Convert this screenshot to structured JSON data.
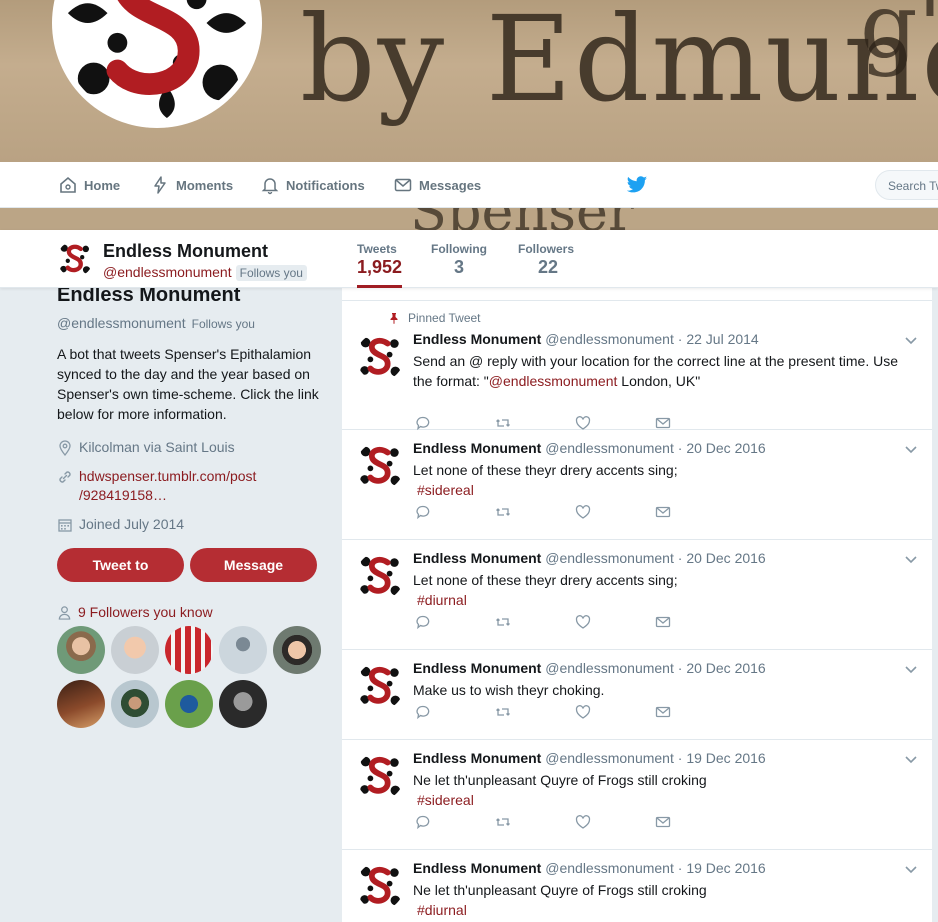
{
  "banner": {
    "text": "by Edmunde",
    "mark": "g'"
  },
  "strip_text": "Spenser",
  "nav": {
    "items": [
      {
        "label": "Home",
        "icon": "home-icon"
      },
      {
        "label": "Moments",
        "icon": "lightning-icon"
      },
      {
        "label": "Notifications",
        "icon": "bell-icon"
      },
      {
        "label": "Messages",
        "icon": "envelope-icon"
      }
    ],
    "search_placeholder": "Search Twitter"
  },
  "profile": {
    "name": "Endless Monument",
    "handle": "@endlessmonument",
    "follows_you": "Follows you",
    "stats": [
      {
        "label": "Tweets",
        "value": "1,952",
        "active": true
      },
      {
        "label": "Following",
        "value": "3"
      },
      {
        "label": "Followers",
        "value": "22"
      }
    ],
    "bio": "A bot that tweets Spenser's Epithalamion synced to the day and the year based on Spenser's own time-scheme. Click the link below for more information.",
    "location": "Kilcolman via Saint Louis",
    "url_line1": "hdwspenser.tumblr.com/post",
    "url_line2": "/928419158…",
    "joined": "Joined July 2014",
    "tweet_to": "Tweet to",
    "message": "Message",
    "followers_you_know": "9 Followers you know"
  },
  "colors": {
    "accent": "#a01d23",
    "link": "#8b1b1f",
    "button": "#b52d33"
  },
  "tweets": [
    {
      "pinned": true,
      "pinned_label": "Pinned Tweet",
      "name": "Endless Monument",
      "handle": "@endlessmonument",
      "date": "· 22 Jul 2014",
      "text_pre": "Send an @ reply with your location for the correct line at the present time. Use the format: \"",
      "text_link": "@endlessmonument",
      "text_post": " London, UK\""
    },
    {
      "name": "Endless Monument",
      "handle": "@endlessmonument",
      "date": "· 20 Dec 2016",
      "text": "Let none of these theyr drery accents sing;",
      "tag": "#sidereal"
    },
    {
      "name": "Endless Monument",
      "handle": "@endlessmonument",
      "date": "· 20 Dec 2016",
      "text": "Let none of these theyr drery accents sing;",
      "tag": "#diurnal"
    },
    {
      "name": "Endless Monument",
      "handle": "@endlessmonument",
      "date": "· 20 Dec 2016",
      "text": "Make us to wish theyr choking."
    },
    {
      "name": "Endless Monument",
      "handle": "@endlessmonument",
      "date": "· 19 Dec 2016",
      "text": "Ne let th'unpleasant Quyre of Frogs still croking",
      "tag": "#sidereal"
    },
    {
      "name": "Endless Monument",
      "handle": "@endlessmonument",
      "date": "· 19 Dec 2016",
      "text": "Ne let th'unpleasant Quyre of Frogs still croking",
      "tag": "#diurnal"
    }
  ]
}
